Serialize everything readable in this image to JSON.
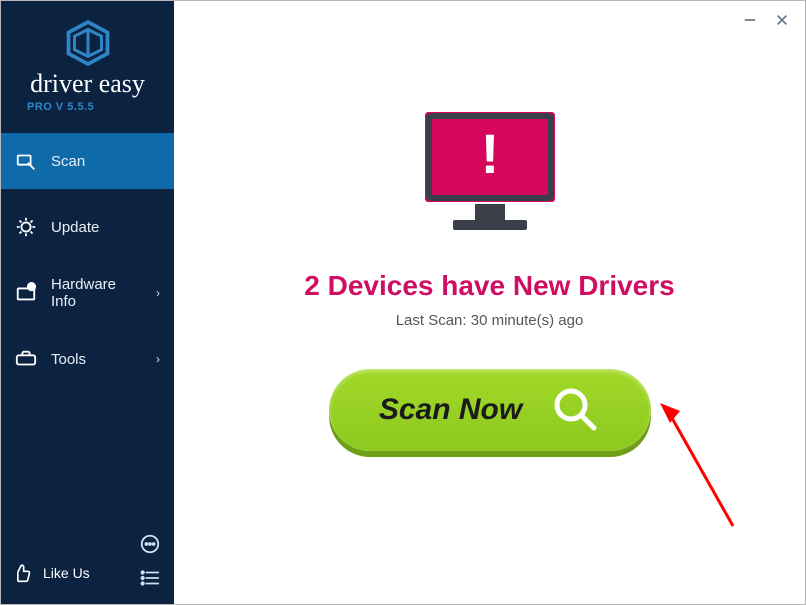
{
  "app": {
    "brand_name": "driver easy",
    "version_label": "PRO V 5.5.5"
  },
  "sidebar": {
    "items": [
      {
        "label": "Scan",
        "icon": "scan-icon",
        "has_submenu": false,
        "active": true
      },
      {
        "label": "Update",
        "icon": "update-icon",
        "has_submenu": false,
        "active": false
      },
      {
        "label": "Hardware Info",
        "icon": "hardware-icon",
        "has_submenu": true,
        "active": false
      },
      {
        "label": "Tools",
        "icon": "tools-icon",
        "has_submenu": true,
        "active": false
      }
    ],
    "like_us_label": "Like Us"
  },
  "main": {
    "headline": "2 Devices have New Drivers",
    "last_scan_label": "Last Scan: 30 minute(s) ago",
    "scan_button_label": "Scan Now"
  },
  "colors": {
    "sidebar_bg": "#0b2340",
    "sidebar_active": "#0f6aa9",
    "accent_magenta": "#cf0d62",
    "scan_green_top": "#a3d92a",
    "scan_green_bottom": "#8cc81e"
  }
}
